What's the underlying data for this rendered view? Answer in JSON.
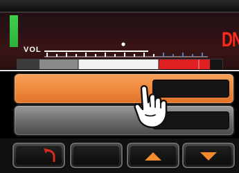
{
  "display": {
    "direction_indicator": "DN",
    "volume_label": "VOL"
  },
  "softkeys": [
    {
      "name": "back",
      "icon": "back-arrow-icon"
    },
    {
      "name": "blank"
    },
    {
      "name": "up",
      "icon": "up-arrow-icon"
    },
    {
      "name": "down",
      "icon": "down-arrow-icon"
    }
  ],
  "colors": {
    "accent_orange": "#ef8a3c",
    "signal_green": "#3ecf4a",
    "indicator_red": "#ff2a1e",
    "meter_red": "#e02020"
  }
}
